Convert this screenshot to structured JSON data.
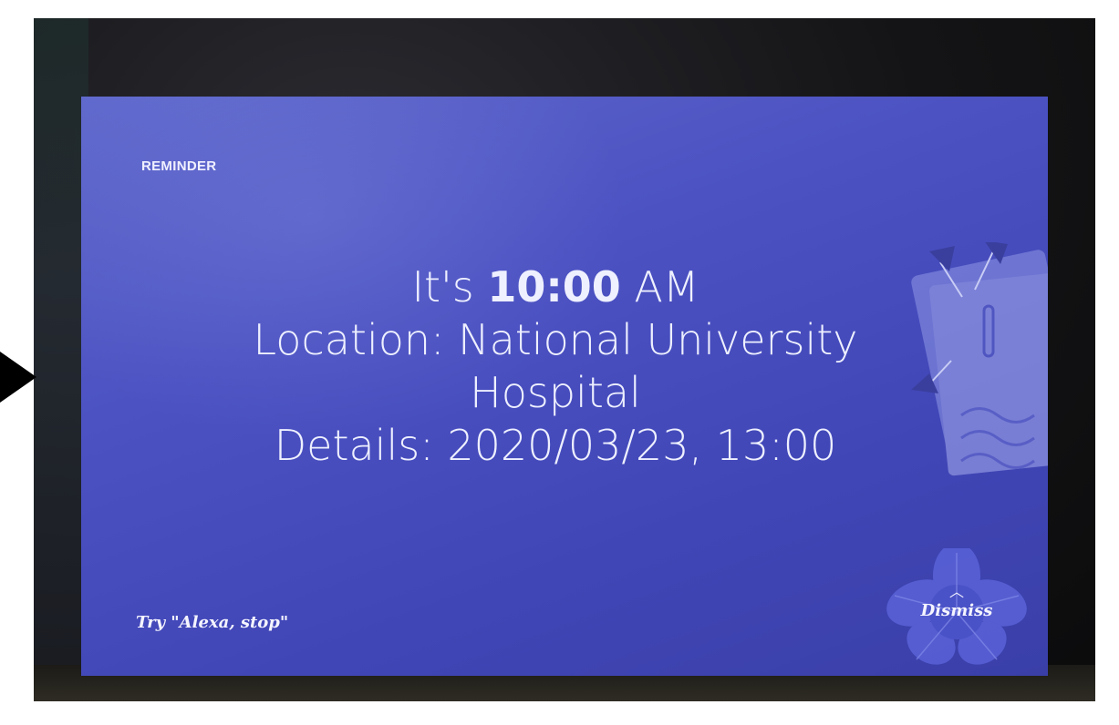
{
  "reminder": {
    "label": "REMINDER",
    "time_prefix": "It's",
    "time_value": "10:00",
    "time_suffix": "AM",
    "location_text": "Location: National University",
    "location_text_line2": "Hospital",
    "details_text": "Details: 2020/03/23, 13:00"
  },
  "footer": {
    "hint": "Try \"Alexa, stop\"",
    "dismiss_label": "Dismiss",
    "dismiss_chevron": "︿"
  },
  "colors": {
    "screen_background": "#4c52c2",
    "text": "#eef0ff"
  },
  "icons": {
    "pointer": "arrow-right-icon",
    "dismiss": "chevron-up-icon",
    "decoration": "notepad-pins-icon",
    "flower": "flower-icon"
  }
}
